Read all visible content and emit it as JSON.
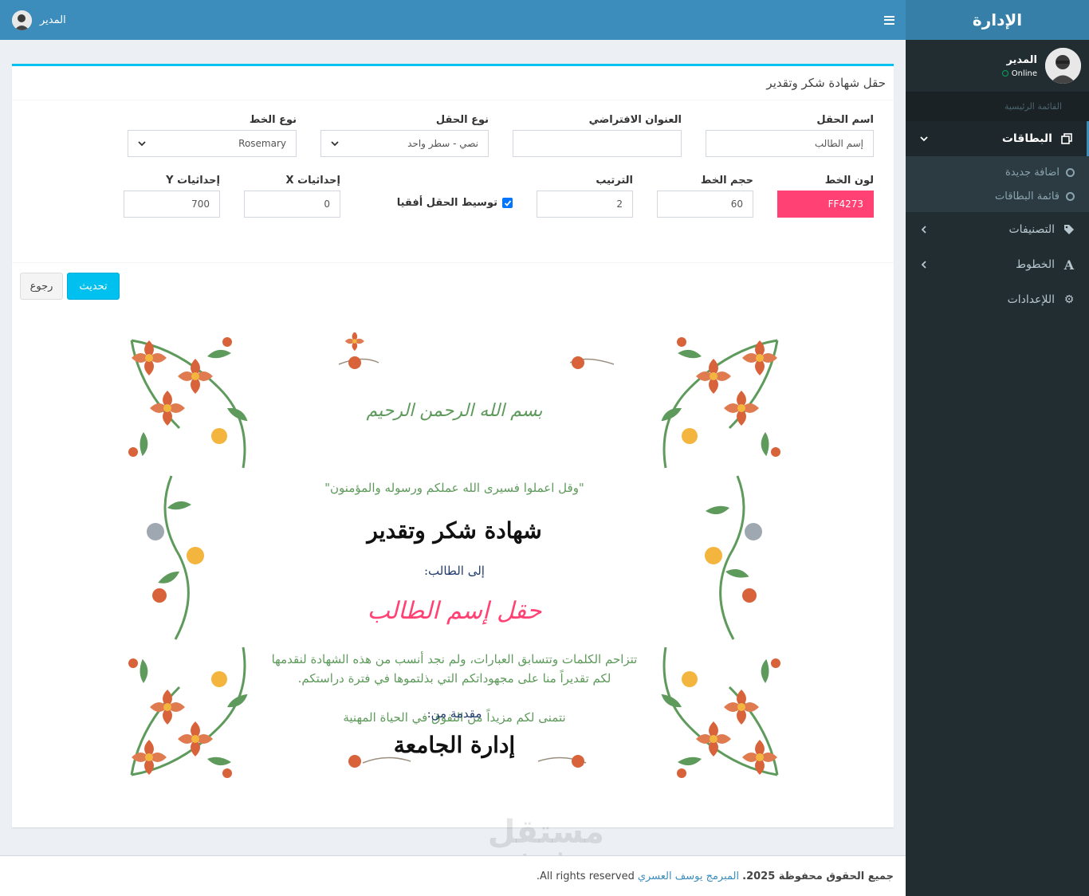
{
  "sidebar": {
    "brand": "الإدارة",
    "user_name": "المدير",
    "user_status": "Online",
    "menu_header": "القائمة الرئيسية",
    "items": [
      {
        "label": "البطاقات"
      },
      {
        "label": "التصنيفات"
      },
      {
        "label": "الخطوط"
      },
      {
        "label": "اللإعدادات"
      }
    ],
    "sub_items": [
      {
        "label": "اضافة جديدة"
      },
      {
        "label": "قائمة البطاقات"
      }
    ]
  },
  "topbar": {
    "user_name": "المدير"
  },
  "box": {
    "title": "حقل شهادة شكر وتقدير",
    "fields": {
      "field_name": {
        "label": "اسم الحقل",
        "value": "إسم الطالب"
      },
      "default_title": {
        "label": "العنوان الافتراضي",
        "value": ""
      },
      "field_type": {
        "label": "نوع الحقل",
        "value": "نصي - سطر واحد"
      },
      "font_type": {
        "label": "نوع الخط",
        "value": "Rosemary"
      },
      "font_color": {
        "label": "لون الخط",
        "value": "FF4273"
      },
      "font_size": {
        "label": "حجم الخط",
        "value": "60"
      },
      "order": {
        "label": "الترتيب",
        "value": "2"
      },
      "center_h": {
        "label": "توسيط الحقل أفقيا"
      },
      "coord_x": {
        "label": "إحداثيات X",
        "value": "0"
      },
      "coord_y": {
        "label": "إحداثيات Y",
        "value": "700"
      }
    },
    "buttons": {
      "update": "تحديث",
      "back": "رجوع"
    }
  },
  "certificate": {
    "basmala": "بسم الله الرحمن الرحيم",
    "verse": "\"وقل اعملوا فسيرى الله عملكم ورسوله والمؤمنون\"",
    "title": "شهادة شكر وتقدير",
    "to": "إلى الطالب:",
    "student_field": "حقل إسم الطالب",
    "body_line1": "تتزاحم الكلمات وتتسابق العبارات، ولم نجد أنسب من هذه الشهادة لنقدمها",
    "body_line2": "لكم تقديراً منا على مجهوداتكم التي بذلتموها في فترة دراستكم.",
    "wish": "نتمنى لكم مزيداً من التفوق في الحياة المهنية",
    "from": "مقدمة من:",
    "signer": "إدارة الجامعة"
  },
  "colors": {
    "accent": "#3c8dbc",
    "student_field": "#ff4273",
    "ornament_green": "#5e9a5b",
    "ornament_orange": "#d8633a",
    "ornament_yellow": "#f3b53e"
  },
  "footer": {
    "rights": "جميع الحقوق محفوظة 2025.",
    "author": "المبرمج يوسف العسري",
    "en": "All rights reserved."
  },
  "watermark": {
    "ar": "مستقل",
    "en": "mostaql.com"
  }
}
